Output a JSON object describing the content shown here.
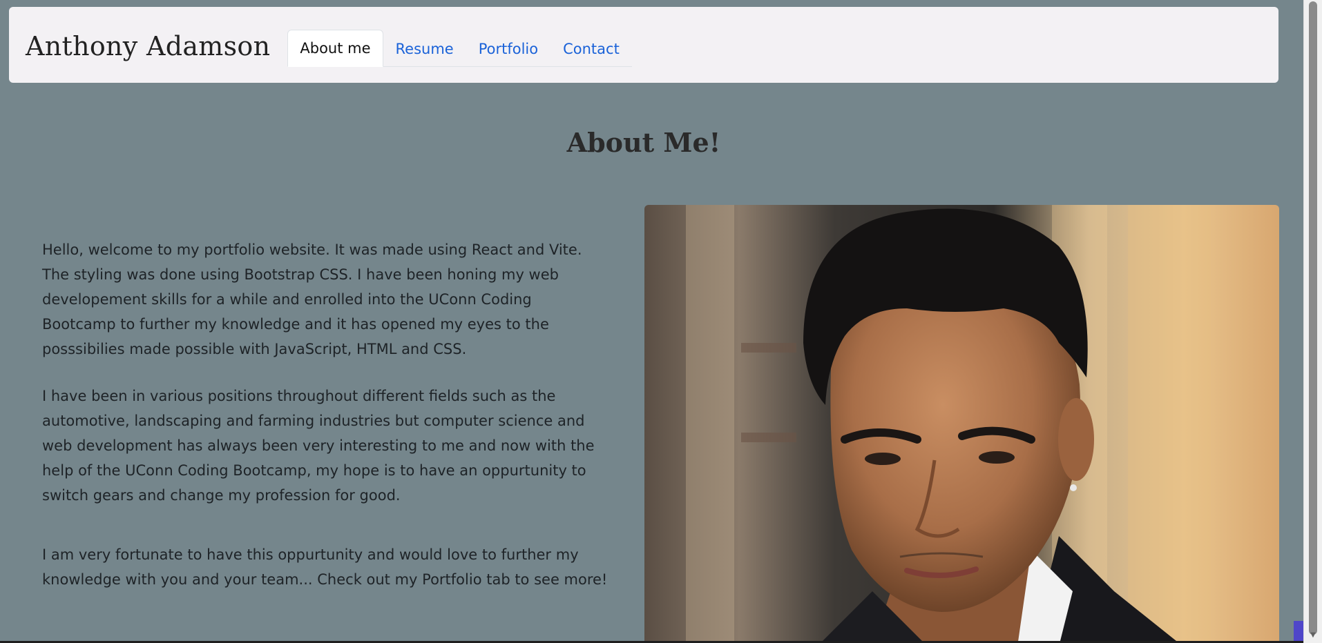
{
  "navbar": {
    "brand": "Anthony Adamson",
    "tabs": [
      {
        "label": "About me",
        "active": true
      },
      {
        "label": "Resume",
        "active": false
      },
      {
        "label": "Portfolio",
        "active": false
      },
      {
        "label": "Contact",
        "active": false
      }
    ]
  },
  "main": {
    "title": "About Me!",
    "paragraphs": [
      "Hello, welcome to my portfolio website. It was made using React and Vite. The styling was done using Bootstrap CSS. I have been honing my web developement skills for a while and enrolled into the UConn Coding Bootcamp to further my knowledge and it has opened my eyes to the posssibilies made possible with JavaScript, HTML and CSS.",
      "I have been in various positions throughout different fields such as the automotive, landscaping and farming industries but computer science and web development has always been very interesting to me and now with the help of the UConn Coding Bootcamp, my hope is to have an oppurtunity to switch gears and change my profession for good.",
      "I am very fortunate to have this oppurtunity and would love to further my knowledge with you and your team... Check out my Portfolio tab to see more!"
    ],
    "photo": {
      "subject": "portrait-photo"
    }
  },
  "colors": {
    "page_bg": "#75868c",
    "navbar_bg": "#f3f1f4",
    "link": "#1a62d8",
    "text": "#1e2327"
  }
}
